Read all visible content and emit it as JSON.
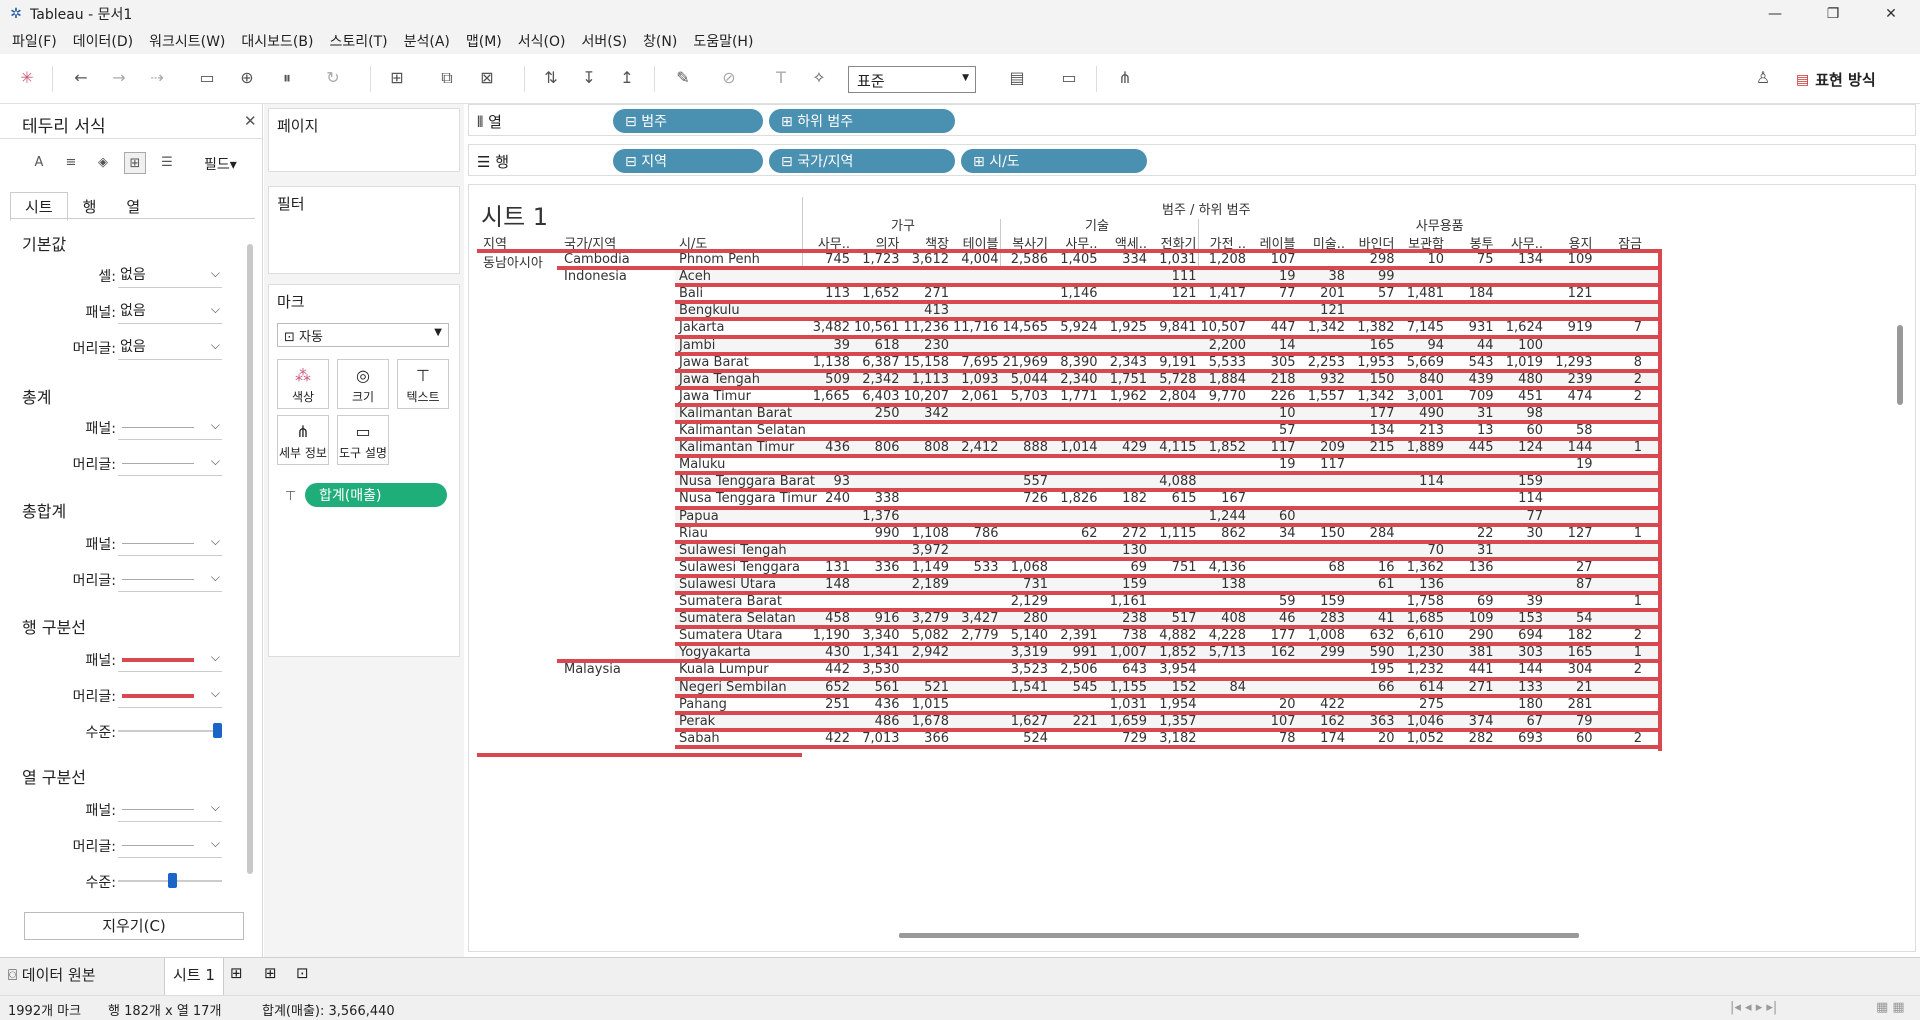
{
  "window": {
    "title": "Tableau - 문서1"
  },
  "menu": [
    "파일(F)",
    "데이터(D)",
    "워크시트(W)",
    "대시보드(B)",
    "스토리(T)",
    "분석(A)",
    "맵(M)",
    "서식(O)",
    "서버(S)",
    "창(N)",
    "도움말(H)"
  ],
  "toolbar": {
    "standard_select": "표준",
    "show_me": "표현 방식"
  },
  "format_pane": {
    "title": "테두리 서식",
    "field_label": "필드▾",
    "tabs": [
      "시트",
      "행",
      "열"
    ],
    "sections": {
      "defaults": "기본값",
      "totals": "총계",
      "grand_totals": "총합계",
      "row_divider": "행 구분선",
      "col_divider": "열 구분선"
    },
    "labels": {
      "cell": "셀:",
      "pane": "패널:",
      "header": "머리글:",
      "level": "수준:"
    },
    "none_value": "없음",
    "row_level": 0.95,
    "col_level": 0.5,
    "clear_button": "지우기(C)"
  },
  "cards": {
    "pages": "페이지",
    "filters": "필터",
    "marks": "마크",
    "marks_type": "자동",
    "mark_buttons": [
      "색상",
      "크기",
      "텍스트",
      "세부 정보",
      "도구 설명"
    ],
    "measure_pill": "합계(매출)"
  },
  "shelves": {
    "columns_label": "열",
    "rows_label": "행",
    "columns": [
      "범주",
      "하위 범주"
    ],
    "rows": [
      "지역",
      "국가/지역",
      "시/도"
    ]
  },
  "sheet": {
    "title": "시트 1",
    "top_header": "범주 / 하위 범주",
    "categories": [
      "가구",
      "기술",
      "사무용품"
    ],
    "row_headers": [
      "지역",
      "국가/지역",
      "시/도"
    ],
    "subcategories": [
      "사무..",
      "의자",
      "책장",
      "테이블",
      "복사기",
      "사무..",
      "액세..",
      "전화기",
      "가전 ..",
      "레이블",
      "미술..",
      "바인더",
      "보관함",
      "봉투",
      "사무..",
      "용지",
      "잠금"
    ],
    "region": "동남아시아",
    "countries": [
      "Cambodia",
      "Indonesia",
      "Malaysia"
    ],
    "rows": [
      {
        "city": "Phnom Penh",
        "v": [
          "745",
          "1,723",
          "3,612",
          "4,004",
          "2,586",
          "1,405",
          "334",
          "1,031",
          "1,208",
          "107",
          "",
          "298",
          "10",
          "75",
          "134",
          "109",
          ""
        ]
      },
      {
        "city": "Aceh",
        "v": [
          "",
          "",
          "",
          "",
          "",
          "",
          "",
          "111",
          "",
          "19",
          "38",
          "99",
          "",
          "",
          "",
          "",
          ""
        ]
      },
      {
        "city": "Bali",
        "v": [
          "113",
          "1,652",
          "271",
          "",
          "",
          "1,146",
          "",
          "121",
          "1,417",
          "77",
          "201",
          "57",
          "1,481",
          "184",
          "",
          "121",
          ""
        ]
      },
      {
        "city": "Bengkulu",
        "v": [
          "",
          "",
          "413",
          "",
          "",
          "",
          "",
          "",
          "",
          "",
          "121",
          "",
          "",
          "",
          "",
          "",
          ""
        ]
      },
      {
        "city": "Jakarta",
        "v": [
          "3,482",
          "10,561",
          "11,236",
          "11,716",
          "14,565",
          "5,924",
          "1,925",
          "9,841",
          "10,507",
          "447",
          "1,342",
          "1,382",
          "7,145",
          "931",
          "1,624",
          "919",
          "7"
        ]
      },
      {
        "city": "Jambi",
        "v": [
          "39",
          "618",
          "230",
          "",
          "",
          "",
          "",
          "",
          "2,200",
          "14",
          "",
          "165",
          "94",
          "44",
          "100",
          "",
          ""
        ]
      },
      {
        "city": "Jawa Barat",
        "v": [
          "1,138",
          "6,387",
          "15,158",
          "7,695",
          "21,969",
          "8,390",
          "2,343",
          "9,191",
          "5,533",
          "305",
          "2,253",
          "1,953",
          "5,669",
          "543",
          "1,019",
          "1,293",
          "8"
        ]
      },
      {
        "city": "Jawa Tengah",
        "v": [
          "509",
          "2,342",
          "1,113",
          "1,093",
          "5,044",
          "2,340",
          "1,751",
          "5,728",
          "1,884",
          "218",
          "932",
          "150",
          "840",
          "439",
          "480",
          "239",
          "2"
        ]
      },
      {
        "city": "Jawa Timur",
        "v": [
          "1,665",
          "6,403",
          "10,207",
          "2,061",
          "5,703",
          "1,771",
          "1,962",
          "2,804",
          "9,770",
          "226",
          "1,557",
          "1,342",
          "3,001",
          "709",
          "451",
          "474",
          "2"
        ]
      },
      {
        "city": "Kalimantan Barat",
        "v": [
          "",
          "250",
          "342",
          "",
          "",
          "",
          "",
          "",
          "",
          "10",
          "",
          "177",
          "490",
          "31",
          "98",
          "",
          ""
        ]
      },
      {
        "city": "Kalimantan Selatan",
        "v": [
          "",
          "",
          "",
          "",
          "",
          "",
          "",
          "",
          "",
          "57",
          "",
          "134",
          "213",
          "13",
          "60",
          "58",
          ""
        ]
      },
      {
        "city": "Kalimantan Timur",
        "v": [
          "436",
          "806",
          "808",
          "2,412",
          "888",
          "1,014",
          "429",
          "4,115",
          "1,852",
          "117",
          "209",
          "215",
          "1,889",
          "445",
          "124",
          "144",
          "1"
        ]
      },
      {
        "city": "Maluku",
        "v": [
          "",
          "",
          "",
          "",
          "",
          "",
          "",
          "",
          "",
          "19",
          "117",
          "",
          "",
          "",
          "",
          "19",
          ""
        ]
      },
      {
        "city": "Nusa Tenggara Barat",
        "v": [
          "93",
          "",
          "",
          "",
          "557",
          "",
          "",
          "4,088",
          "",
          "",
          "",
          "",
          "114",
          "",
          "159",
          "",
          ""
        ]
      },
      {
        "city": "Nusa Tenggara Timur",
        "v": [
          "240",
          "338",
          "",
          "",
          "726",
          "1,826",
          "182",
          "615",
          "167",
          "",
          "",
          "",
          "",
          "",
          "114",
          "",
          ""
        ]
      },
      {
        "city": "Papua",
        "v": [
          "",
          "1,376",
          "",
          "",
          "",
          "",
          "",
          "",
          "1,244",
          "60",
          "",
          "",
          "",
          "",
          "77",
          "",
          ""
        ]
      },
      {
        "city": "Riau",
        "v": [
          "",
          "990",
          "1,108",
          "786",
          "",
          "62",
          "272",
          "1,115",
          "862",
          "34",
          "150",
          "284",
          "",
          "22",
          "30",
          "127",
          "1"
        ]
      },
      {
        "city": "Sulawesi Tengah",
        "v": [
          "",
          "",
          "3,972",
          "",
          "",
          "",
          "130",
          "",
          "",
          "",
          "",
          "",
          "70",
          "31",
          "",
          "",
          ""
        ]
      },
      {
        "city": "Sulawesi Tenggara",
        "v": [
          "131",
          "336",
          "1,149",
          "533",
          "1,068",
          "",
          "69",
          "751",
          "4,136",
          "",
          "68",
          "16",
          "1,362",
          "136",
          "",
          "27",
          ""
        ]
      },
      {
        "city": "Sulawesi Utara",
        "v": [
          "148",
          "",
          "2,189",
          "",
          "731",
          "",
          "159",
          "",
          "138",
          "",
          "",
          "61",
          "136",
          "",
          "",
          "87",
          ""
        ]
      },
      {
        "city": "Sumatera Barat",
        "v": [
          "",
          "",
          "",
          "",
          "2,129",
          "",
          "1,161",
          "",
          "",
          "59",
          "159",
          "",
          "1,758",
          "69",
          "39",
          "",
          "1"
        ]
      },
      {
        "city": "Sumatera Selatan",
        "v": [
          "458",
          "916",
          "3,279",
          "3,427",
          "280",
          "",
          "238",
          "517",
          "408",
          "46",
          "283",
          "41",
          "1,685",
          "109",
          "153",
          "54",
          ""
        ]
      },
      {
        "city": "Sumatera Utara",
        "v": [
          "1,190",
          "3,340",
          "5,082",
          "2,779",
          "5,140",
          "2,391",
          "738",
          "4,882",
          "4,228",
          "177",
          "1,008",
          "632",
          "6,610",
          "290",
          "694",
          "182",
          "2"
        ]
      },
      {
        "city": "Yogyakarta",
        "v": [
          "430",
          "1,341",
          "2,942",
          "",
          "3,319",
          "991",
          "1,007",
          "1,852",
          "5,713",
          "162",
          "299",
          "590",
          "1,230",
          "381",
          "303",
          "165",
          "1"
        ]
      },
      {
        "city": "Kuala Lumpur",
        "v": [
          "442",
          "3,530",
          "",
          "",
          "3,523",
          "2,506",
          "643",
          "3,954",
          "",
          "",
          "",
          "195",
          "1,232",
          "441",
          "144",
          "304",
          "2"
        ]
      },
      {
        "city": "Negeri Sembilan",
        "v": [
          "652",
          "561",
          "521",
          "",
          "1,541",
          "545",
          "1,155",
          "152",
          "84",
          "",
          "",
          "66",
          "614",
          "271",
          "133",
          "21",
          ""
        ]
      },
      {
        "city": "Pahang",
        "v": [
          "251",
          "436",
          "1,015",
          "",
          "",
          "",
          "1,031",
          "1,954",
          "",
          "20",
          "422",
          "",
          "275",
          "",
          "180",
          "281",
          ""
        ]
      },
      {
        "city": "Perak",
        "v": [
          "",
          "486",
          "1,678",
          "",
          "1,627",
          "221",
          "1,659",
          "1,357",
          "",
          "107",
          "162",
          "363",
          "1,046",
          "374",
          "67",
          "79",
          ""
        ]
      },
      {
        "city": "Sabah",
        "v": [
          "422",
          "7,013",
          "366",
          "",
          "524",
          "",
          "729",
          "3,182",
          "",
          "78",
          "174",
          "20",
          "1,052",
          "282",
          "693",
          "60",
          "2"
        ]
      }
    ]
  },
  "bottom_tabs": {
    "datasource": "데이터 원본",
    "sheet": "시트 1"
  },
  "status": {
    "marks": "1992개 마크",
    "rows_cols": "행 182개 x 열 17개",
    "sum": "합계(매출): 3,566,440"
  },
  "colors": {
    "divider": "#d9474f",
    "pill_blue": "#4a90b0",
    "pill_green": "#1fae7a"
  }
}
